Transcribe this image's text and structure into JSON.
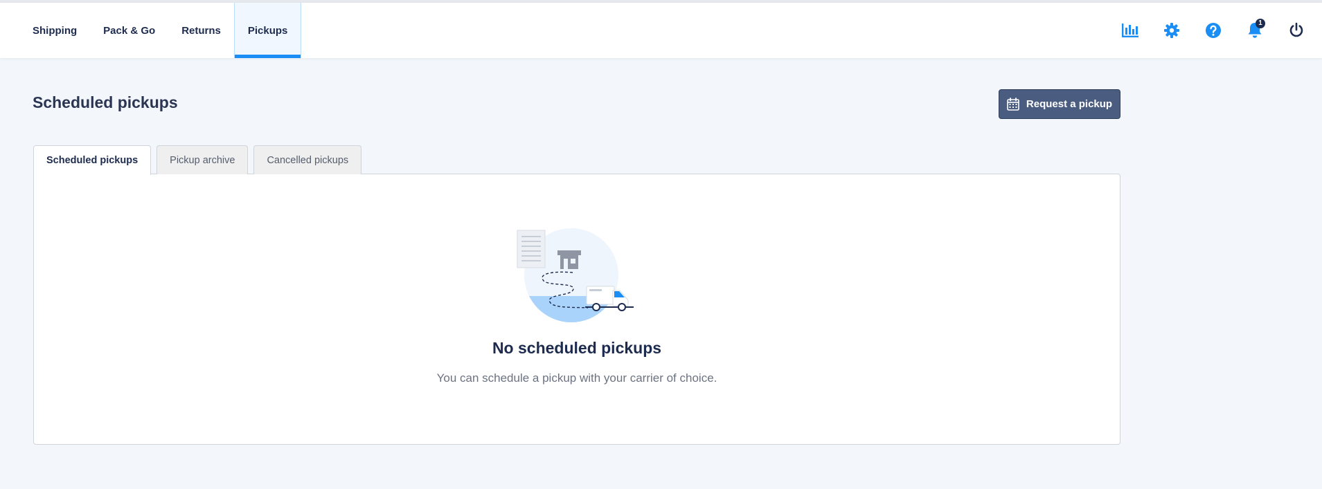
{
  "nav": {
    "tabs": [
      {
        "label": "Shipping"
      },
      {
        "label": "Pack & Go"
      },
      {
        "label": "Returns"
      },
      {
        "label": "Pickups"
      }
    ],
    "active_tab": "Pickups",
    "icons": [
      "bar-chart-icon",
      "gear-icon",
      "help-icon",
      "bell-icon",
      "power-icon"
    ],
    "notification_count": "1",
    "accent_color": "#1a8ef5"
  },
  "page": {
    "title": "Scheduled pickups",
    "request_button_label": "Request a pickup"
  },
  "tabs": [
    {
      "label": "Scheduled pickups"
    },
    {
      "label": "Pickup archive"
    },
    {
      "label": "Cancelled pickups"
    }
  ],
  "active_tab": "Scheduled pickups",
  "empty_state": {
    "title": "No scheduled pickups",
    "message": "You can schedule a pickup with your carrier of choice."
  }
}
